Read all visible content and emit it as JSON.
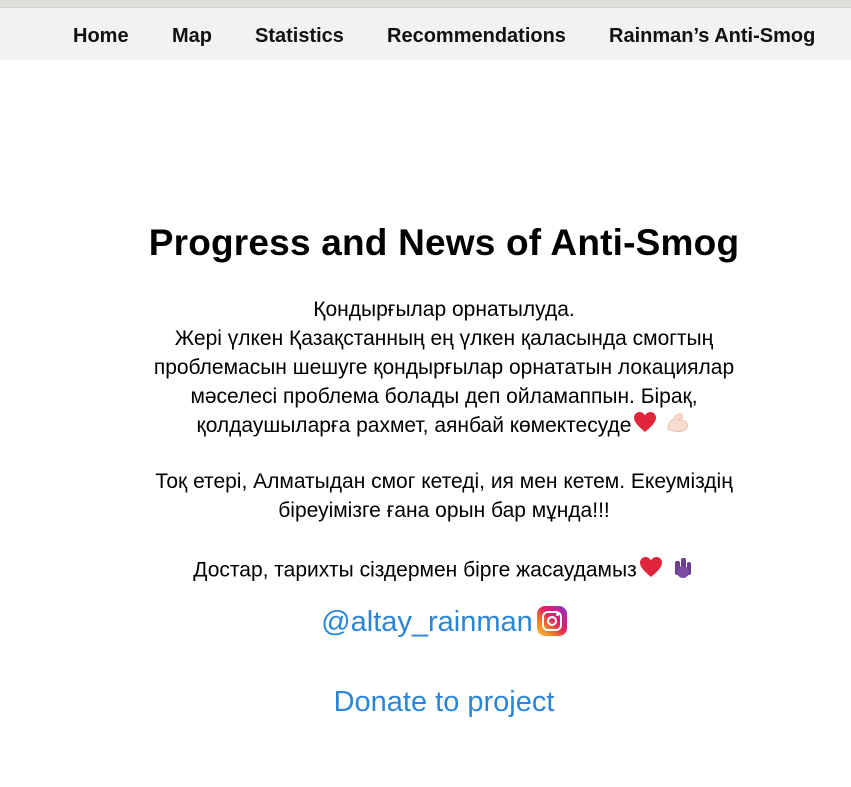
{
  "nav": {
    "items": [
      {
        "label": "Home"
      },
      {
        "label": "Map"
      },
      {
        "label": "Statistics"
      },
      {
        "label": "Recommendations"
      },
      {
        "label": "Rainman’s Anti-Smog"
      }
    ]
  },
  "main": {
    "title": "Progress and News of Anti-Smog",
    "paragraph1": {
      "line1": "Қондырғылар орнатылуда.",
      "line2": "Жері үлкен Қазақстанның ең үлкен қаласында смогтың",
      "line3": "проблемасын шешуге қондырғылар орнататын локациялар",
      "line4": "мәселесі проблема болады деп ойламаппын. Бірақ,",
      "line5": "қолдаушыларға рахмет, аянбай көмектесуде"
    },
    "paragraph2": {
      "line1": "Тоқ етері, Алматыдан смог кетеді, ия мен кетем. Екеуміздің",
      "line2": "біреуімізге ғана орын бар мұнда!!!"
    },
    "paragraph3": {
      "line1": "Достар, тарихты сіздермен бірге жасаудамыз"
    },
    "instagram_handle": "@altay_rainman",
    "donate_label": "Donate to project"
  },
  "icons": {
    "heart": "red-heart-icon",
    "flexed_arm": "flexed-biceps-icon",
    "hands": "raised-hands-icon",
    "instagram": "instagram-icon"
  },
  "colors": {
    "link": "#2a85d9",
    "heart": "#e0243a",
    "navbar_bg": "#f2f2f2"
  }
}
